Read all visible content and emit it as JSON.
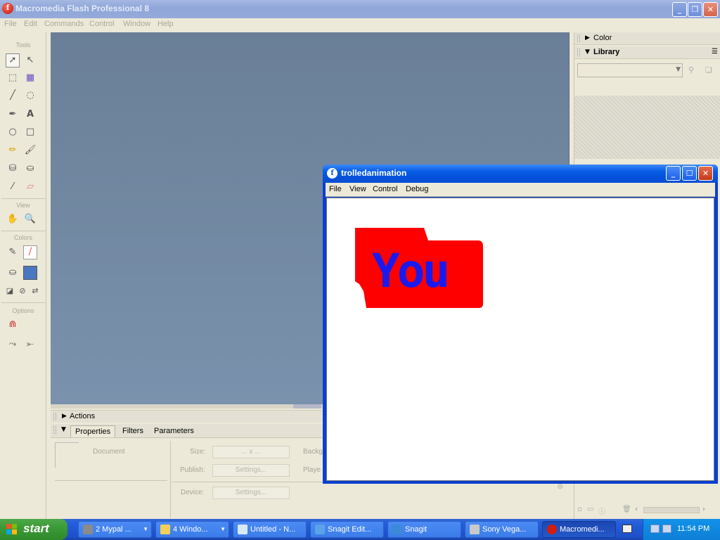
{
  "main_window": {
    "title": "Macromedia Flash Professional 8",
    "menu": [
      "File",
      "Edit",
      "Commands",
      "Control",
      "Window",
      "Help"
    ]
  },
  "tools_panel": {
    "sections": {
      "tools": "Tools",
      "view": "View",
      "colors": "Colors",
      "options": "Options"
    }
  },
  "bottom_panels": {
    "actions_label": "Actions",
    "tabs": [
      "Properties",
      "Filters",
      "Parameters"
    ],
    "document_label": "Document",
    "size_label": "Size:",
    "size_value": "... x ...",
    "publish_label": "Publish:",
    "settings_button": "Settings...",
    "device_label": "Device:",
    "device_settings_button": "Settings...",
    "background_label": "Backg",
    "player_label": "Playe"
  },
  "right_panels": {
    "color_label": "Color",
    "library_label": "Library"
  },
  "player_window": {
    "title": "trolledanimation",
    "menu": [
      "File",
      "View",
      "Control",
      "Debug"
    ],
    "canvas_text": "You",
    "colors": {
      "blob": "#ff0000",
      "text": "#1a1aee"
    }
  },
  "taskbar": {
    "start_label": "start",
    "tasks": [
      {
        "label": "2 Mypal ...",
        "icon": "raccoon-icon"
      },
      {
        "label": "4 Windo...",
        "icon": "folder-icon"
      },
      {
        "label": "Untitled - N...",
        "icon": "notepad-icon"
      },
      {
        "label": "Snagit Edit...",
        "icon": "snagit-editor-icon"
      },
      {
        "label": "Snagit",
        "icon": "snagit-icon"
      },
      {
        "label": "Sony Vega...",
        "icon": "vegas-icon"
      },
      {
        "label": "Macromedi...",
        "icon": "flash-icon"
      }
    ],
    "clock": "11:54 PM"
  }
}
